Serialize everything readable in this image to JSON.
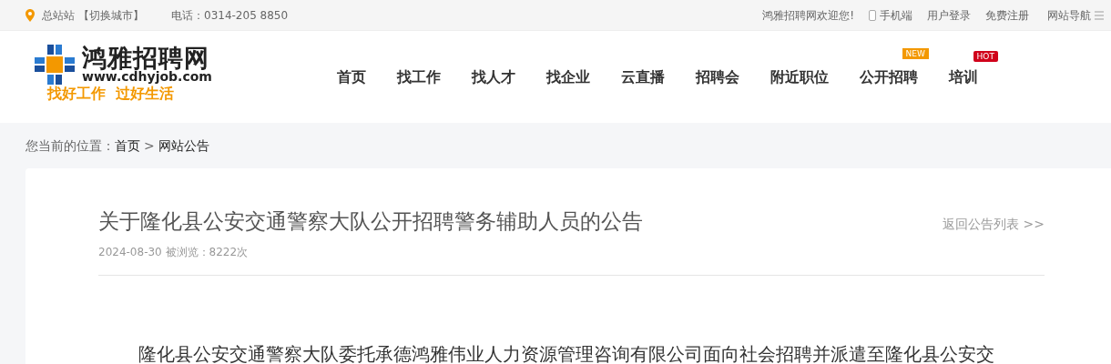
{
  "top_bar": {
    "location": "总站站",
    "switch_city": "【切换城市】",
    "phone": "电话：0314-205 8850",
    "welcome": "鸿雅招聘网欢迎您!",
    "mobile": "手机端",
    "login": "用户登录",
    "register": "免费注册",
    "site_nav": "网站导航"
  },
  "logo": {
    "name": "鸿雅招聘网",
    "url": "www.cdhyjob.com",
    "slogan": "找好工作  过好生活"
  },
  "nav": [
    {
      "label": "首页"
    },
    {
      "label": "找工作"
    },
    {
      "label": "找人才"
    },
    {
      "label": "找企业"
    },
    {
      "label": "云直播"
    },
    {
      "label": "招聘会"
    },
    {
      "label": "附近职位"
    },
    {
      "label": "公开招聘",
      "badge": {
        "kind": "new",
        "text": "NEW"
      }
    },
    {
      "label": "培训",
      "badge": {
        "kind": "hot",
        "text": "HOT"
      }
    }
  ],
  "breadcrumb": {
    "prefix": "您当前的位置：",
    "items": [
      "首页",
      "网站公告"
    ],
    "separator": ">"
  },
  "article": {
    "title": "关于隆化县公安交通警察大队公开招聘警务辅助人员的公告",
    "meta": "2024-08-30 被浏览：8222次",
    "back_link": "返回公告列表 >>",
    "body": "隆化县公安交通警察大队委托承德鸿雅伟业人力资源管理咨询有限公司面向社会招聘并派遣至隆化县公安交"
  }
}
